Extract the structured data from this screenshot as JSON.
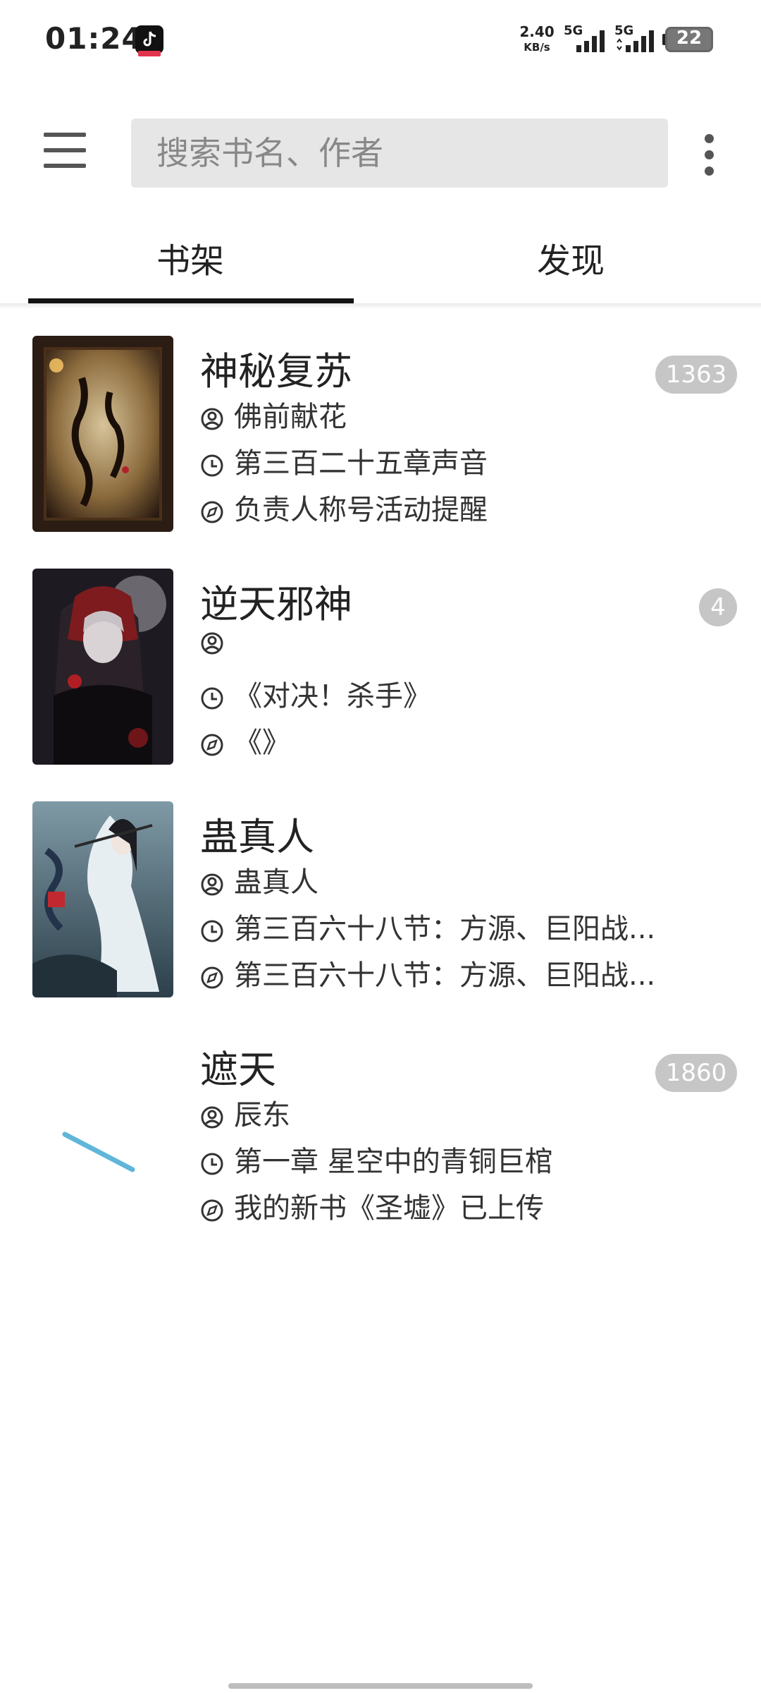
{
  "status_bar": {
    "time": "01:24",
    "net_rate": "2.40",
    "net_rate_unit": "KB/s",
    "sim1": "5G",
    "sim2": "5G",
    "battery": "22"
  },
  "toolbar": {
    "search_placeholder": "搜索书名、作者",
    "menu_icon": "hamburger-menu-icon",
    "more_icon": "more-vert-icon"
  },
  "tabs": [
    {
      "label": "书架",
      "active": true
    },
    {
      "label": "发现",
      "active": false
    }
  ],
  "books": [
    {
      "title": "神秘复苏",
      "author": "佛前献花",
      "latest_chapter": "第三百二十五章声音",
      "last_read": "负责人称号活动提醒",
      "unread": "1363"
    },
    {
      "title": "逆天邪神",
      "author": "",
      "latest_chapter": "《对决！杀手》",
      "last_read": "《》",
      "unread": "4"
    },
    {
      "title": "蛊真人",
      "author": "蛊真人",
      "latest_chapter": "第三百六十八节：方源、巨阳战...",
      "last_read": "第三百六十八节：方源、巨阳战...",
      "unread": ""
    },
    {
      "title": "遮天",
      "author": "辰东",
      "latest_chapter": "第一章 星空中的青铜巨棺",
      "last_read": "我的新书《圣墟》已上传",
      "unread": "1860"
    }
  ],
  "colors": {
    "badge_bg": "#c6c6c6",
    "search_bg": "#e6e6e6",
    "tab_indicator": "#111111"
  }
}
